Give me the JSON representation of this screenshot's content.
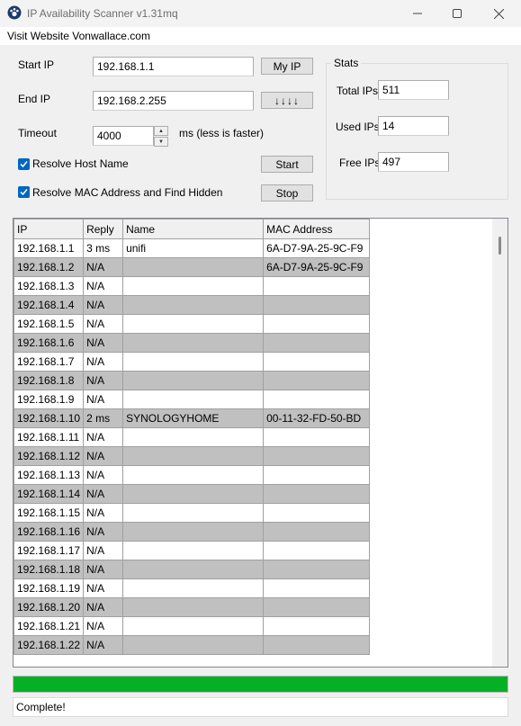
{
  "window": {
    "title": "IP Availability Scanner v1.31mq"
  },
  "menu": {
    "item": "Visit Website Vonwallace.com"
  },
  "form": {
    "start_ip_label": "Start IP",
    "start_ip_value": "192.168.1.1",
    "my_ip_button": "My IP",
    "end_ip_label": "End IP",
    "end_ip_value": "192.168.2.255",
    "arrows_button": "↓↓↓↓",
    "timeout_label": "Timeout",
    "timeout_value": "4000",
    "timeout_hint": "ms (less is faster)",
    "resolve_host_label": "Resolve Host Name",
    "resolve_mac_label": "Resolve MAC Address and Find Hidden",
    "start_button": "Start",
    "stop_button": "Stop"
  },
  "stats": {
    "title": "Stats",
    "total_label": "Total IPs",
    "total_value": "511",
    "used_label": "Used IPs",
    "used_value": "14",
    "free_label": "Free IPs",
    "free_value": "497"
  },
  "table": {
    "columns": [
      "IP",
      "Reply",
      "Name",
      "MAC Address"
    ],
    "rows": [
      [
        "192.168.1.1",
        "3 ms",
        "unifi",
        "6A-D7-9A-25-9C-F9"
      ],
      [
        "192.168.1.2",
        "N/A",
        "",
        "6A-D7-9A-25-9C-F9"
      ],
      [
        "192.168.1.3",
        "N/A",
        "",
        ""
      ],
      [
        "192.168.1.4",
        "N/A",
        "",
        ""
      ],
      [
        "192.168.1.5",
        "N/A",
        "",
        ""
      ],
      [
        "192.168.1.6",
        "N/A",
        "",
        ""
      ],
      [
        "192.168.1.7",
        "N/A",
        "",
        ""
      ],
      [
        "192.168.1.8",
        "N/A",
        "",
        ""
      ],
      [
        "192.168.1.9",
        "N/A",
        "",
        ""
      ],
      [
        "192.168.1.10",
        "2 ms",
        "SYNOLOGYHOME",
        "00-11-32-FD-50-BD"
      ],
      [
        "192.168.1.11",
        "N/A",
        "",
        ""
      ],
      [
        "192.168.1.12",
        "N/A",
        "",
        ""
      ],
      [
        "192.168.1.13",
        "N/A",
        "",
        ""
      ],
      [
        "192.168.1.14",
        "N/A",
        "",
        ""
      ],
      [
        "192.168.1.15",
        "N/A",
        "",
        ""
      ],
      [
        "192.168.1.16",
        "N/A",
        "",
        ""
      ],
      [
        "192.168.1.17",
        "N/A",
        "",
        ""
      ],
      [
        "192.168.1.18",
        "N/A",
        "",
        ""
      ],
      [
        "192.168.1.19",
        "N/A",
        "",
        ""
      ],
      [
        "192.168.1.20",
        "N/A",
        "",
        ""
      ],
      [
        "192.168.1.21",
        "N/A",
        "",
        ""
      ],
      [
        "192.168.1.22",
        "N/A",
        "",
        ""
      ]
    ]
  },
  "progress": {
    "fraction": 1.0
  },
  "status": {
    "text": "Complete!"
  },
  "colors": {
    "accent": "#0067c0",
    "progress": "#06b025",
    "alt_row": "#c0c0c0"
  },
  "icons": [
    "app-icon",
    "minimize-icon",
    "maximize-icon",
    "close-icon",
    "check-icon",
    "spin-up-icon",
    "spin-down-icon"
  ]
}
